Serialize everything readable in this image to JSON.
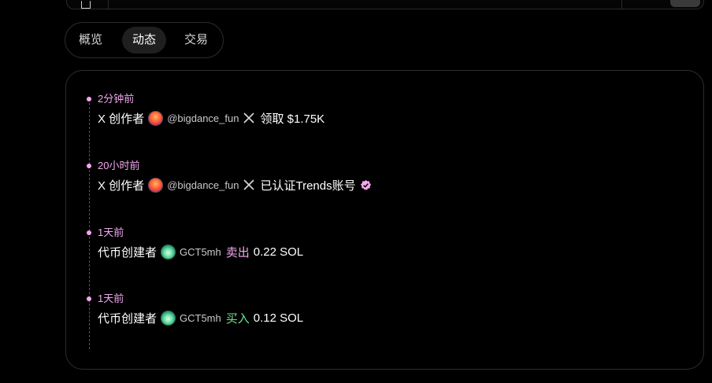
{
  "tabs": [
    {
      "label": "概览",
      "active": false
    },
    {
      "label": "动态",
      "active": true
    },
    {
      "label": "交易",
      "active": false
    }
  ],
  "accent_color": "#f3a7ef",
  "buy_color": "#6ee48e",
  "activities": [
    {
      "time": "2分钟前",
      "role": "X 创作者",
      "avatar_icon": "fire-avatar",
      "handle": "@bigdance_fun",
      "platform_icon": "x-icon",
      "action": "领取 $1.75K"
    },
    {
      "time": "20小时前",
      "role": "X 创作者",
      "avatar_icon": "fire-avatar",
      "handle": "@bigdance_fun",
      "platform_icon": "x-icon",
      "action": "已认证Trends账号",
      "badge_icon": "verified-badge-icon"
    },
    {
      "time": "1天前",
      "role": "代币创建者",
      "avatar_icon": "green-flame-avatar",
      "handle": "GCT5mh",
      "trade_type": "卖出",
      "amount": "0.22 SOL"
    },
    {
      "time": "1天前",
      "role": "代币创建者",
      "avatar_icon": "green-flame-avatar",
      "handle": "GCT5mh",
      "trade_type": "买入",
      "amount": "0.12 SOL"
    }
  ]
}
